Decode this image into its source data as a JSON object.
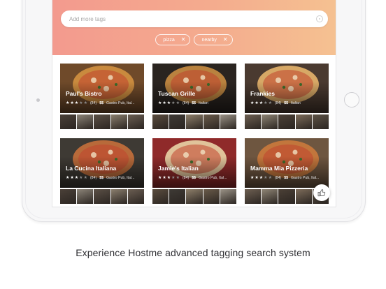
{
  "search": {
    "placeholder": "Add more tags"
  },
  "tags": [
    {
      "label": "pizza"
    },
    {
      "label": "nearby"
    }
  ],
  "restaurants": [
    {
      "name": "Paul's Bistro",
      "stars": 3,
      "reviews": "(84)",
      "price": "$$",
      "cuisine": "Gastro Pub, Ital...",
      "hero": "#6f4a2a",
      "pizza": "#c98a3e",
      "thumbs": [
        "#4a4038",
        "#8c8478",
        "#5b5046",
        "#8a7e6d",
        "#6b5e52"
      ]
    },
    {
      "name": "Tuscan Grille",
      "stars": 3,
      "reviews": "(84)",
      "price": "$$",
      "cuisine": "Italian",
      "hero": "#2a2420",
      "pizza": "#b9823f",
      "thumbs": [
        "#5a4c3e",
        "#3e3a35",
        "#8e7f6a",
        "#6a5b4a",
        "#9a9286"
      ]
    },
    {
      "name": "Frankies",
      "stars": 3,
      "reviews": "(84)",
      "price": "$$",
      "cuisine": "Italian",
      "hero": "#4a3a30",
      "pizza": "#d7a866",
      "thumbs": [
        "#6e6052",
        "#8f8575",
        "#4b4036",
        "#7d6c5a",
        "#5e5346"
      ]
    },
    {
      "name": "La Cucina Italiana",
      "stars": 3,
      "reviews": "(84)",
      "price": "$$",
      "cuisine": "Gastro Pub, Ital...",
      "hero": "#3e3a34",
      "pizza": "#b86a3a",
      "thumbs": [
        "#4a4038",
        "#8c8478",
        "#5b5046",
        "#8a7e6d",
        "#6b5e52"
      ]
    },
    {
      "name": "Jamie's Italian",
      "stars": 3,
      "reviews": "(84)",
      "price": "$$",
      "cuisine": "Gastro Pub, Ital...",
      "hero": "#8f2a2a",
      "pizza": "#e0c39a",
      "thumbs": [
        "#5a4c3e",
        "#3e3a35",
        "#8e7f6a",
        "#6a5b4a",
        "#9a9286"
      ]
    },
    {
      "name": "Mamma Mia Pizzeria",
      "stars": 3,
      "reviews": "(84)",
      "price": "$$",
      "cuisine": "Gastro Pub, Ital...",
      "hero": "#6e5640",
      "pizza": "#c2763c",
      "thumbs": [
        "#6e6052",
        "#8f8575",
        "#4b4036",
        "#7d6c5a",
        "#5e5346"
      ]
    }
  ],
  "caption": "Experience Hostme advanced tagging search system",
  "icons": {
    "search_clear": "clear-circle-icon",
    "fab": "thumbs-up-icon",
    "tag_remove": "close-icon"
  },
  "colors": {
    "header_start": "#f39a8e",
    "header_end": "#f5c191"
  }
}
